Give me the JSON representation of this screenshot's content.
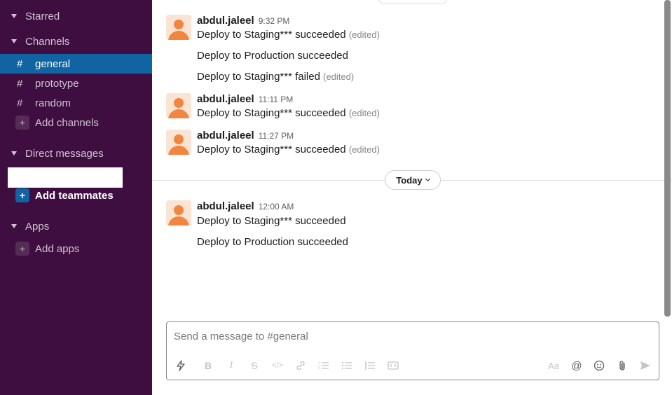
{
  "sidebar": {
    "starred": "Starred",
    "channels_header": "Channels",
    "channels": [
      {
        "name": "general",
        "active": true
      },
      {
        "name": "prototype",
        "active": false
      },
      {
        "name": "random",
        "active": false
      }
    ],
    "add_channels": "Add channels",
    "dm_header": "Direct messages",
    "add_teammates": "Add teammates",
    "apps_header": "Apps",
    "add_apps": "Add apps"
  },
  "messages": [
    {
      "author": "abdul.jaleel",
      "time": "9:32 PM",
      "lines": [
        {
          "text": "Deploy to Staging*** succeeded",
          "edited": "(edited)"
        },
        {
          "text": "Deploy to Production succeeded",
          "edited": ""
        },
        {
          "text": "Deploy to Staging*** failed",
          "edited": "(edited)"
        }
      ]
    },
    {
      "author": "abdul.jaleel",
      "time": "11:11 PM",
      "lines": [
        {
          "text": "Deploy to Staging*** succeeded",
          "edited": "(edited)"
        }
      ]
    },
    {
      "author": "abdul.jaleel",
      "time": "11:27 PM",
      "lines": [
        {
          "text": "Deploy to Staging*** succeeded",
          "edited": "(edited)"
        }
      ]
    },
    {
      "author": "abdul.jaleel",
      "time": "12:00 AM",
      "lines": [
        {
          "text": "Deploy to Staging*** succeeded",
          "edited": ""
        },
        {
          "text": "Deploy to Production succeeded",
          "edited": ""
        }
      ]
    }
  ],
  "divider_label": "Today",
  "composer": {
    "placeholder": "Send a message to #general"
  },
  "icons": {
    "shortcuts": "lightning-icon",
    "bold": "bold-icon",
    "italic": "italic-icon",
    "strike": "strikethrough-icon",
    "code": "code-icon",
    "link": "link-icon",
    "ordered": "ordered-list-icon",
    "bulleted": "bulleted-list-icon",
    "blockquote": "blockquote-icon",
    "codeblock": "code-block-icon",
    "format": "text-format-icon",
    "mention": "at-icon",
    "emoji": "emoji-icon",
    "attach": "paperclip-icon",
    "send": "send-icon"
  },
  "colors": {
    "sidebar_bg": "#3f0e40",
    "active_channel": "#1164a3",
    "avatar": "#f0863f"
  }
}
